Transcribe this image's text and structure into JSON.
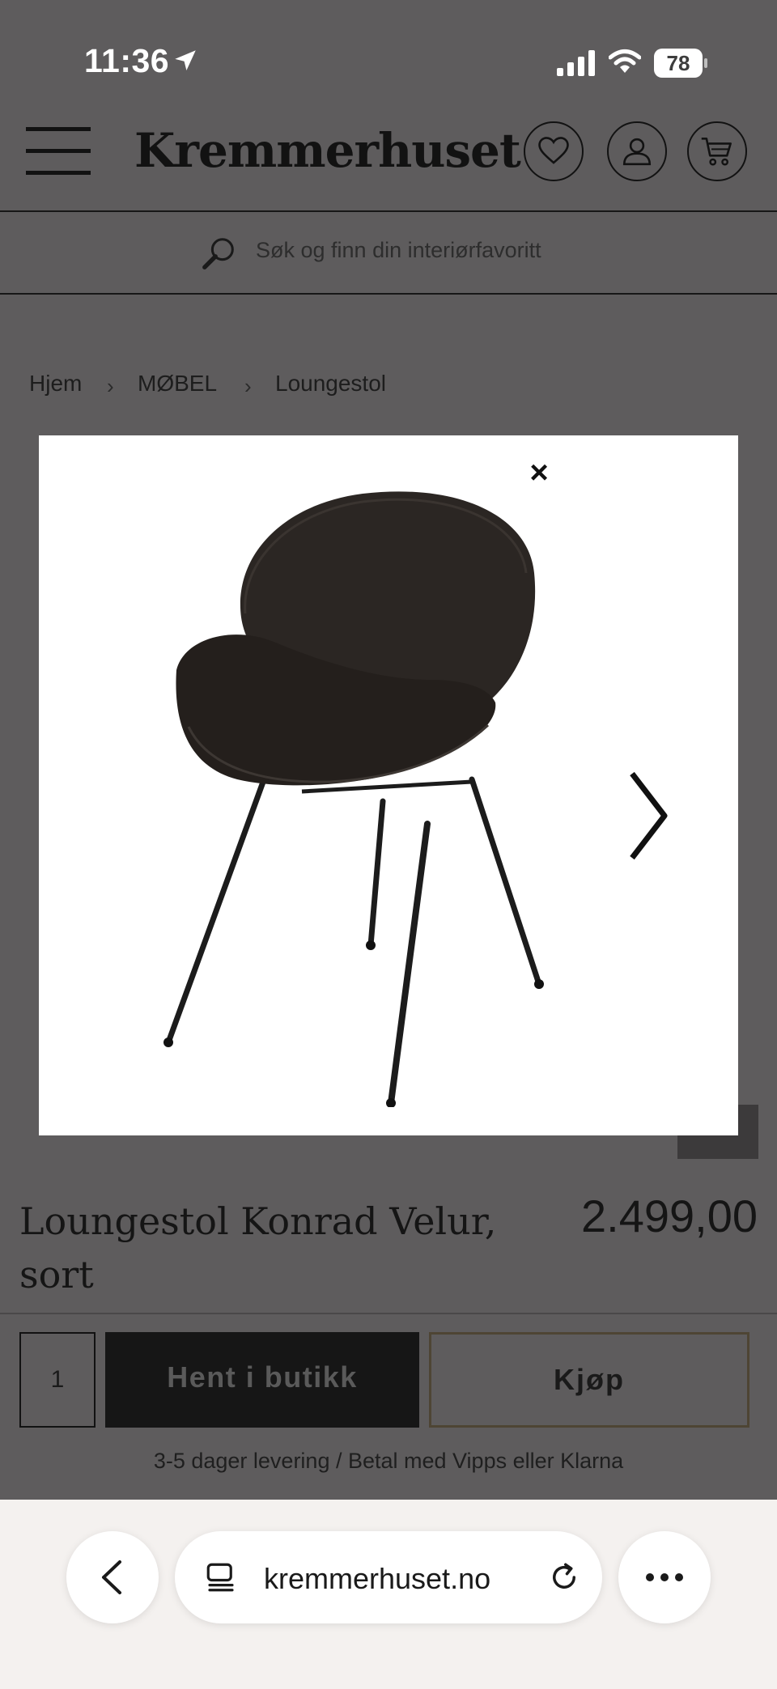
{
  "status_bar": {
    "time": "11:36",
    "battery_level": "78"
  },
  "header": {
    "brand": "Kremmerhuset",
    "icons": [
      "menu-icon",
      "heart-icon",
      "user-icon",
      "cart-icon"
    ]
  },
  "search": {
    "placeholder": "Søk og finn din interiørfavoritt"
  },
  "breadcrumb": {
    "items": [
      "Hjem",
      "MØBEL",
      "Loungestol"
    ],
    "separator": "›"
  },
  "lightbox": {
    "close_label": "×",
    "image_subject": "chair-image"
  },
  "product": {
    "title": "Loungestol Konrad Velur, sort",
    "price": "2.499,00"
  },
  "purchase": {
    "quantity": "1",
    "pickup_label": "Hent i butikk",
    "buy_label": "Kjøp",
    "delivery_note": "3-5 dager levering / Betal med Vipps eller Klarna"
  },
  "browser": {
    "url": "kremmerhuset.no"
  },
  "colors": {
    "overlay": "#5e5c5d",
    "text": "#151515",
    "pickup_button": "#161616",
    "buy_border": "#4e4534"
  }
}
